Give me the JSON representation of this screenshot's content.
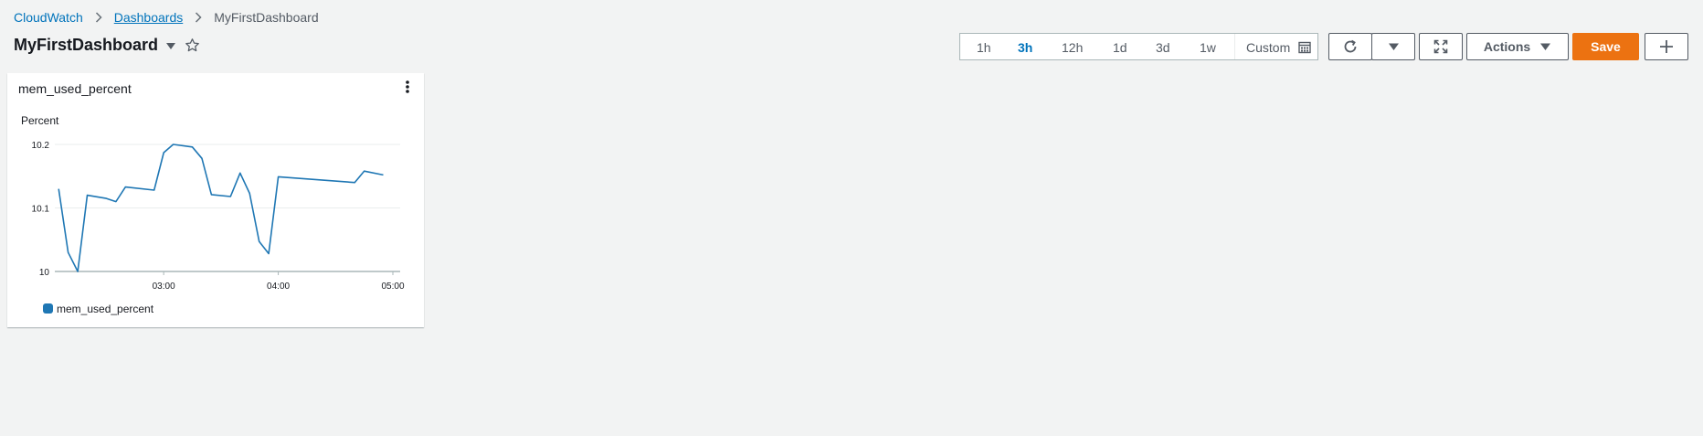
{
  "breadcrumb": {
    "root": "CloudWatch",
    "parent": "Dashboards",
    "current": "MyFirstDashboard"
  },
  "dashboard": {
    "title": "MyFirstDashboard"
  },
  "time_range": {
    "options": [
      "1h",
      "3h",
      "12h",
      "1d",
      "3d",
      "1w"
    ],
    "selected": "3h",
    "custom_label": "Custom"
  },
  "toolbar": {
    "actions_label": "Actions",
    "save_label": "Save"
  },
  "icons": {
    "refresh": "refresh-icon",
    "refresh_options": "caret-down-icon",
    "fullscreen": "fullscreen-icon",
    "add": "plus-icon",
    "calendar": "calendar-icon",
    "favorite": "star-icon",
    "widget_menu": "vertical-ellipsis-icon"
  },
  "colors": {
    "accent_link": "#0073bb",
    "save_button": "#ec7211",
    "series_line": "#1f77b4"
  },
  "widget": {
    "title": "mem_used_percent",
    "y_unit_label": "Percent",
    "legend_label": "mem_used_percent"
  },
  "chart_data": {
    "type": "line",
    "title": "mem_used_percent",
    "ylabel": "Percent",
    "xlabel": "",
    "x_ticks": [
      "03:00",
      "04:00",
      "05:00"
    ],
    "y_ticks": [
      "10",
      "10.1",
      "10.2"
    ],
    "ylim": [
      10,
      10.2
    ],
    "xlim_hours": [
      2.05,
      5.0
    ],
    "grid": true,
    "legend_position": "bottom-left",
    "series": [
      {
        "name": "mem_used_percent",
        "color": "#1f77b4",
        "x": [
          "02:05",
          "02:10",
          "02:15",
          "02:20",
          "02:30",
          "02:35",
          "02:40",
          "02:55",
          "03:00",
          "03:05",
          "03:15",
          "03:20",
          "03:25",
          "03:35",
          "03:40",
          "03:45",
          "03:50",
          "03:55",
          "04:00",
          "04:40",
          "04:45",
          "04:55"
        ],
        "y": [
          10.13,
          10.03,
          10.0,
          10.12,
          10.115,
          10.11,
          10.133,
          10.128,
          10.187,
          10.2,
          10.196,
          10.178,
          10.121,
          10.118,
          10.155,
          10.123,
          10.047,
          10.028,
          10.149,
          10.14,
          10.158,
          10.152
        ]
      }
    ]
  }
}
